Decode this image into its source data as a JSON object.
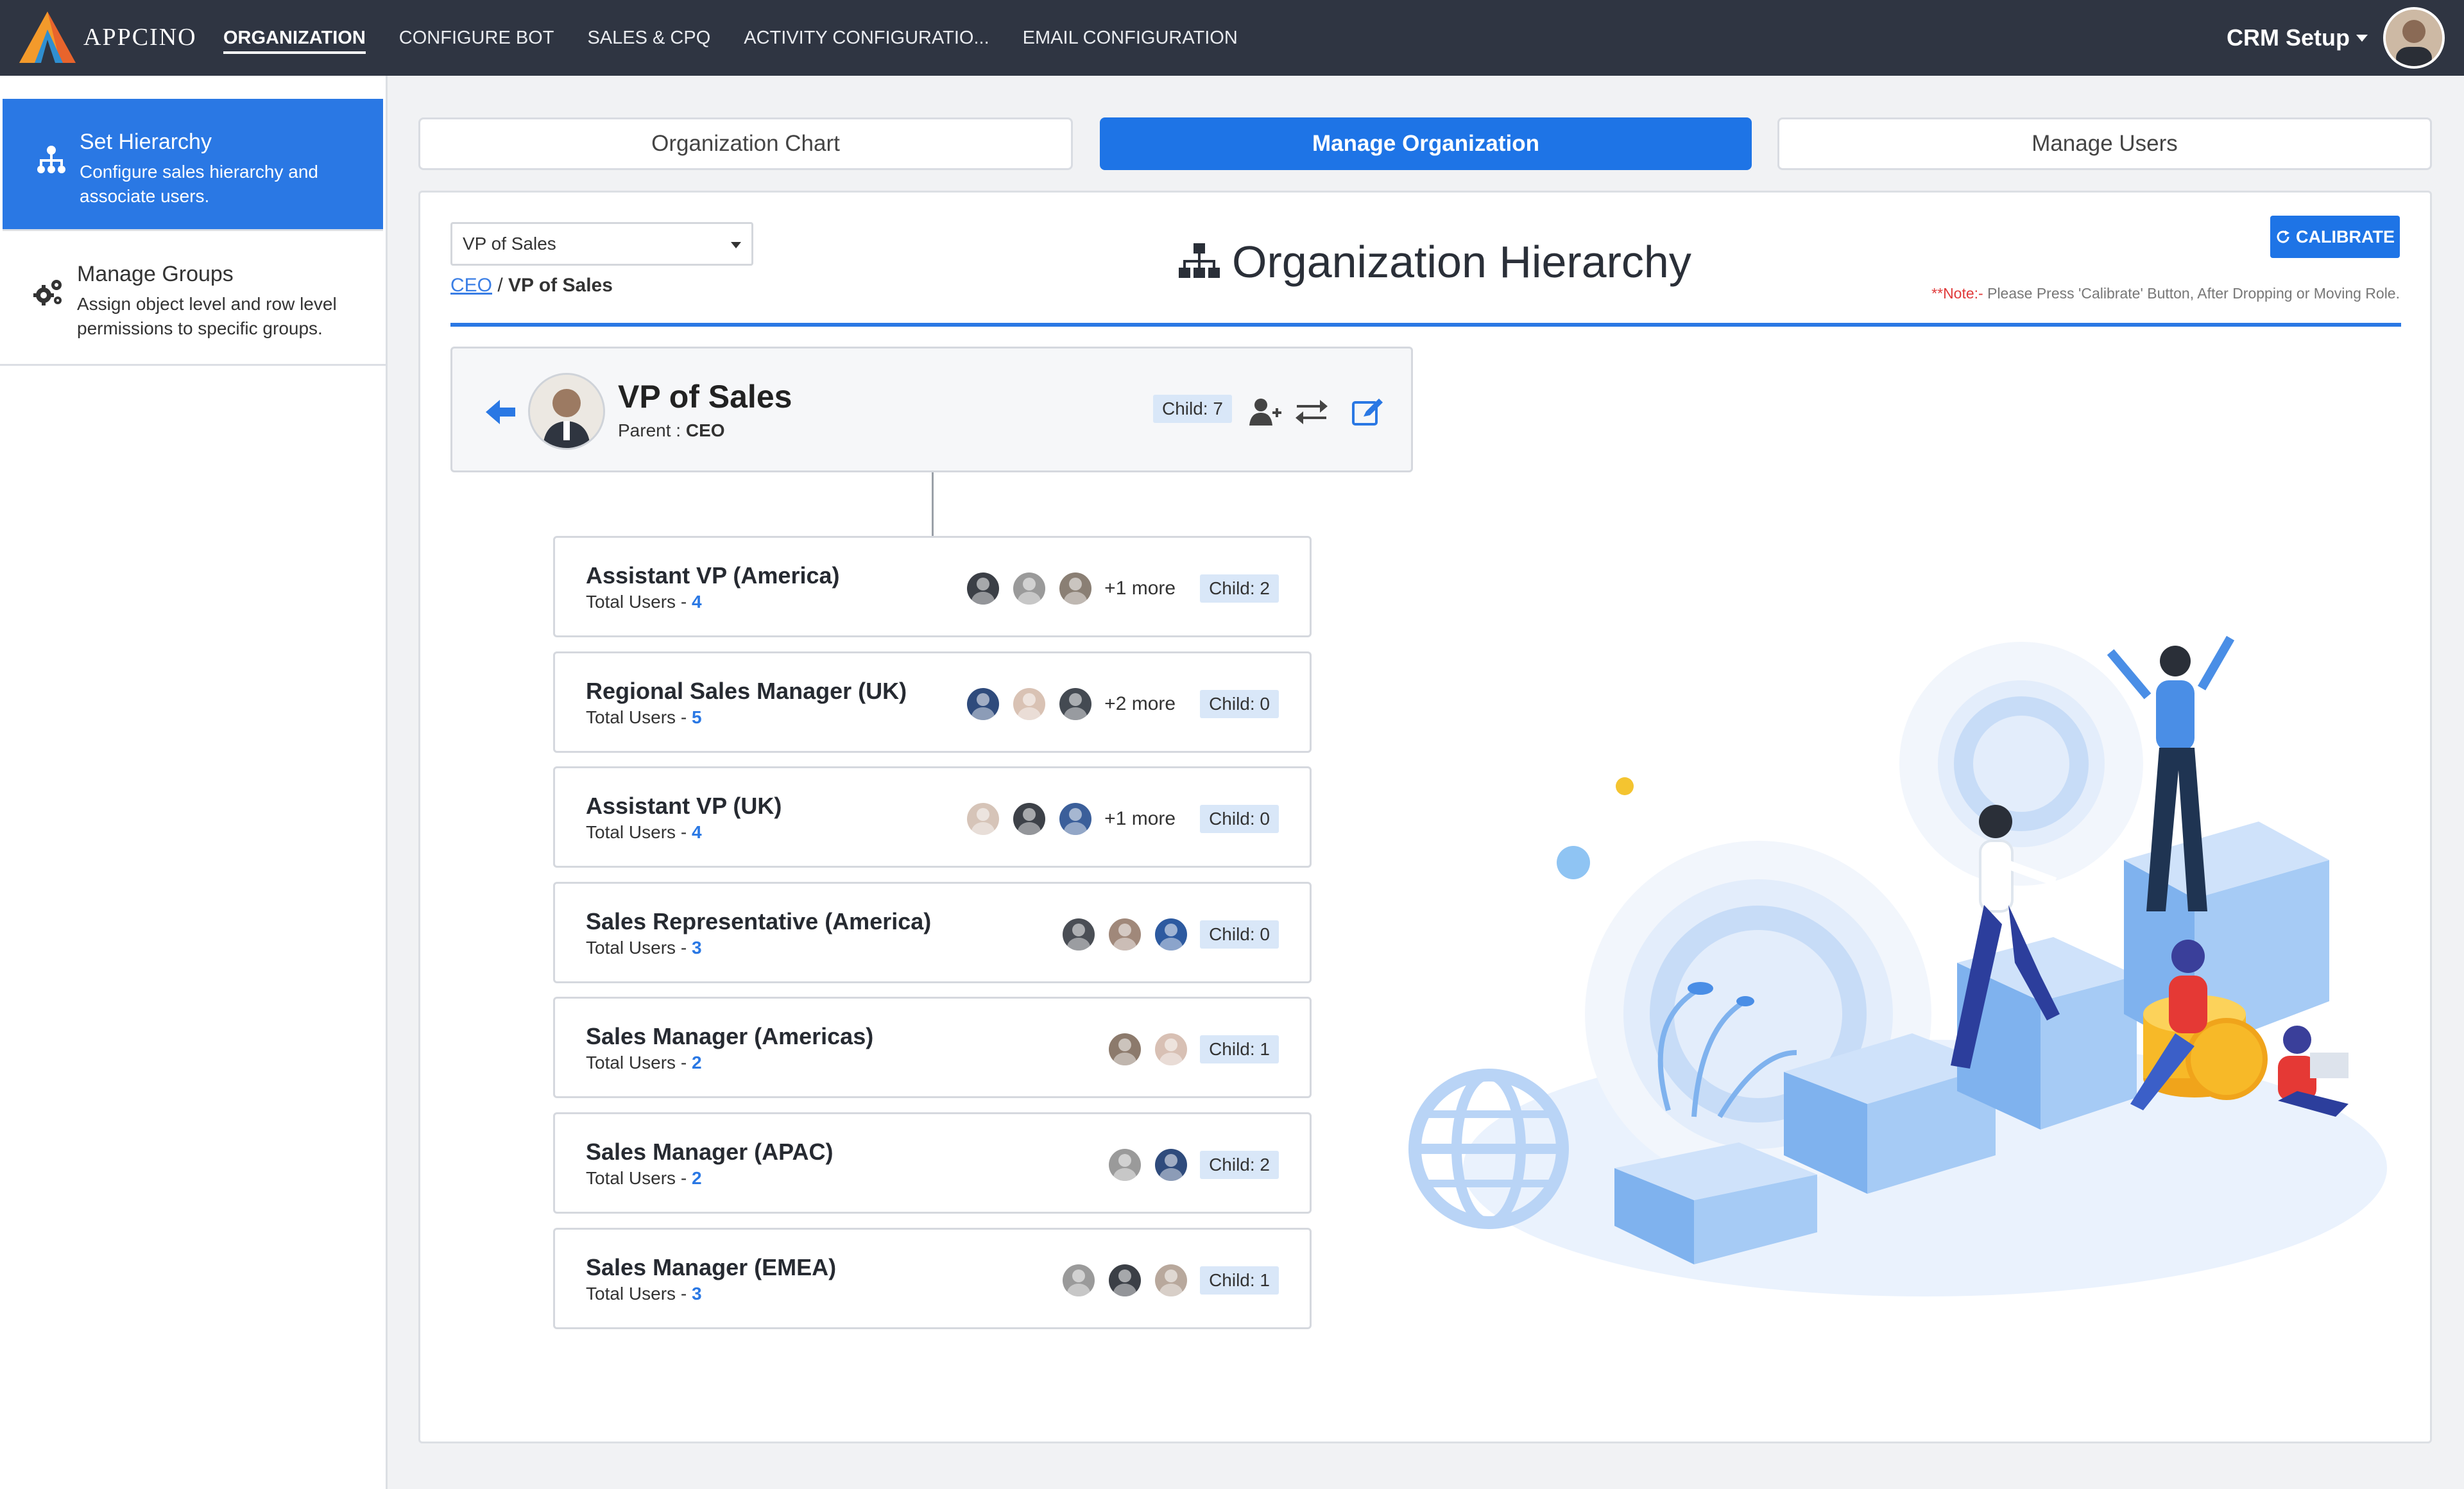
{
  "brand": {
    "name": "APPCINO"
  },
  "nav": {
    "items": [
      "ORGANIZATION",
      "CONFIGURE BOT",
      "SALES & CPQ",
      "ACTIVITY CONFIGURATIO...",
      "EMAIL CONFIGURATION"
    ],
    "active": "ORGANIZATION",
    "right_label": "CRM Setup"
  },
  "sidebar": {
    "items": [
      {
        "title": "Set Hierarchy",
        "desc": "Configure sales hierarchy and associate users.",
        "icon": "hierarchy-icon"
      },
      {
        "title": "Manage Groups",
        "desc": "Assign object level and row level permissions to specific groups.",
        "icon": "gears-icon"
      }
    ]
  },
  "tabs": {
    "t0": "Organization Chart",
    "t1": "Manage Organization",
    "t2": "Manage Users",
    "active": "Manage Organization"
  },
  "main": {
    "select_value": "VP of Sales",
    "breadcrumb": {
      "root": "CEO",
      "sep": "/",
      "current": "VP of Sales"
    },
    "title": "Organization Hierarchy",
    "calibrate_label": "CALIBRATE",
    "note_prefix": "**Note:-",
    "note_text": "Please Press 'Calibrate' Button, After Dropping or Moving Role."
  },
  "parent": {
    "name": "VP of Sales",
    "parent_label": "Parent :",
    "parent_value": "CEO",
    "child_badge": "Child: 7",
    "icons": [
      "add-user-icon",
      "swap-icon",
      "edit-icon"
    ]
  },
  "children": [
    {
      "name": "Assistant VP (America)",
      "users_label": "Total Users - ",
      "users": "4",
      "more": "+1 more",
      "child": "Child: 2",
      "avatar_colors": [
        "#3b3f46",
        "#9a9a9a",
        "#8a7f74"
      ]
    },
    {
      "name": "Regional Sales Manager (UK)",
      "users_label": "Total Users - ",
      "users": "5",
      "more": "+2 more",
      "child": "Child: 0",
      "avatar_colors": [
        "#2f4b7c",
        "#d9c2b4",
        "#444a52"
      ]
    },
    {
      "name": "Assistant VP (UK)",
      "users_label": "Total Users - ",
      "users": "4",
      "more": "+1 more",
      "child": "Child: 0",
      "avatar_colors": [
        "#d6c4b8",
        "#3d4148",
        "#3b5f9a"
      ]
    },
    {
      "name": "Sales Representative (America)",
      "users_label": "Total Users - ",
      "users": "3",
      "more": "",
      "child": "Child: 0",
      "avatar_colors": [
        "#4a4e55",
        "#a0887a",
        "#2d5aa0"
      ]
    },
    {
      "name": "Sales Manager (Americas)",
      "users_label": "Total Users - ",
      "users": "2",
      "more": "",
      "child": "Child: 1",
      "avatar_colors": [
        "#8c7a6c",
        "#d8c0b4"
      ]
    },
    {
      "name": "Sales Manager (APAC)",
      "users_label": "Total Users - ",
      "users": "2",
      "more": "",
      "child": "Child: 2",
      "avatar_colors": [
        "#9a9a9a",
        "#2f4b7c"
      ]
    },
    {
      "name": "Sales Manager (EMEA)",
      "users_label": "Total Users - ",
      "users": "3",
      "more": "",
      "child": "Child: 1",
      "avatar_colors": [
        "#9a9a9a",
        "#3b3f46",
        "#b8a89c"
      ]
    }
  ],
  "colors": {
    "nav_bg": "#2f3542",
    "accent": "#1e74e6",
    "badge_bg": "#d9e7f8"
  }
}
